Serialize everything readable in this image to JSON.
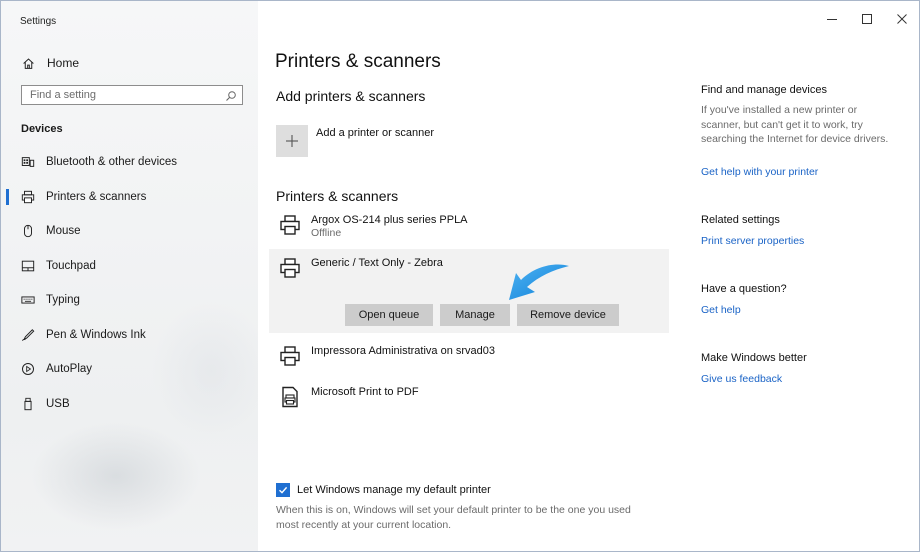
{
  "window": {
    "app_title": "Settings",
    "controls": {
      "minimize": "—",
      "maximize": "☐",
      "close": "✕"
    }
  },
  "sidebar": {
    "home_label": "Home",
    "search_placeholder": "Find a setting",
    "section_title": "Devices",
    "items": [
      {
        "label": "Bluetooth & other devices",
        "icon": "bluetooth-devices-icon",
        "active": false
      },
      {
        "label": "Printers & scanners",
        "icon": "printer-icon",
        "active": true
      },
      {
        "label": "Mouse",
        "icon": "mouse-icon",
        "active": false
      },
      {
        "label": "Touchpad",
        "icon": "touchpad-icon",
        "active": false
      },
      {
        "label": "Typing",
        "icon": "keyboard-icon",
        "active": false
      },
      {
        "label": "Pen & Windows Ink",
        "icon": "pen-icon",
        "active": false
      },
      {
        "label": "AutoPlay",
        "icon": "autoplay-icon",
        "active": false
      },
      {
        "label": "USB",
        "icon": "usb-icon",
        "active": false
      }
    ]
  },
  "main": {
    "page_title": "Printers & scanners",
    "add_section_title": "Add printers & scanners",
    "add_button_label": "Add a printer or scanner",
    "list_title": "Printers & scanners",
    "printers": [
      {
        "name": "Argox OS-214 plus series PPLA",
        "status": "Offline"
      },
      {
        "name": "Generic / Text Only - Zebra",
        "status": ""
      },
      {
        "name": "Impressora Administrativa on srvad03",
        "status": ""
      },
      {
        "name": "Microsoft Print to PDF",
        "status": ""
      }
    ],
    "selected_actions": {
      "open_queue": "Open queue",
      "manage": "Manage",
      "remove": "Remove device"
    },
    "default_printer": {
      "checked": true,
      "label": "Let Windows manage my default printer",
      "description": "When this is on, Windows will set your default printer to be the one you used most recently at your current location."
    }
  },
  "right": {
    "find_title": "Find and manage devices",
    "find_text": "If you've installed a new printer or scanner, but can't get it to work, try searching the Internet for device drivers.",
    "find_link": "Get help with your printer",
    "related_title": "Related settings",
    "related_link": "Print server properties",
    "question_title": "Have a question?",
    "question_link": "Get help",
    "better_title": "Make Windows better",
    "better_link": "Give us feedback"
  },
  "colors": {
    "accent": "#1f6fd1",
    "link": "#1a63c6",
    "arrow": "#1a8fe3",
    "button_bg": "#cccccc",
    "selected_row_bg": "#f2f2f2"
  }
}
